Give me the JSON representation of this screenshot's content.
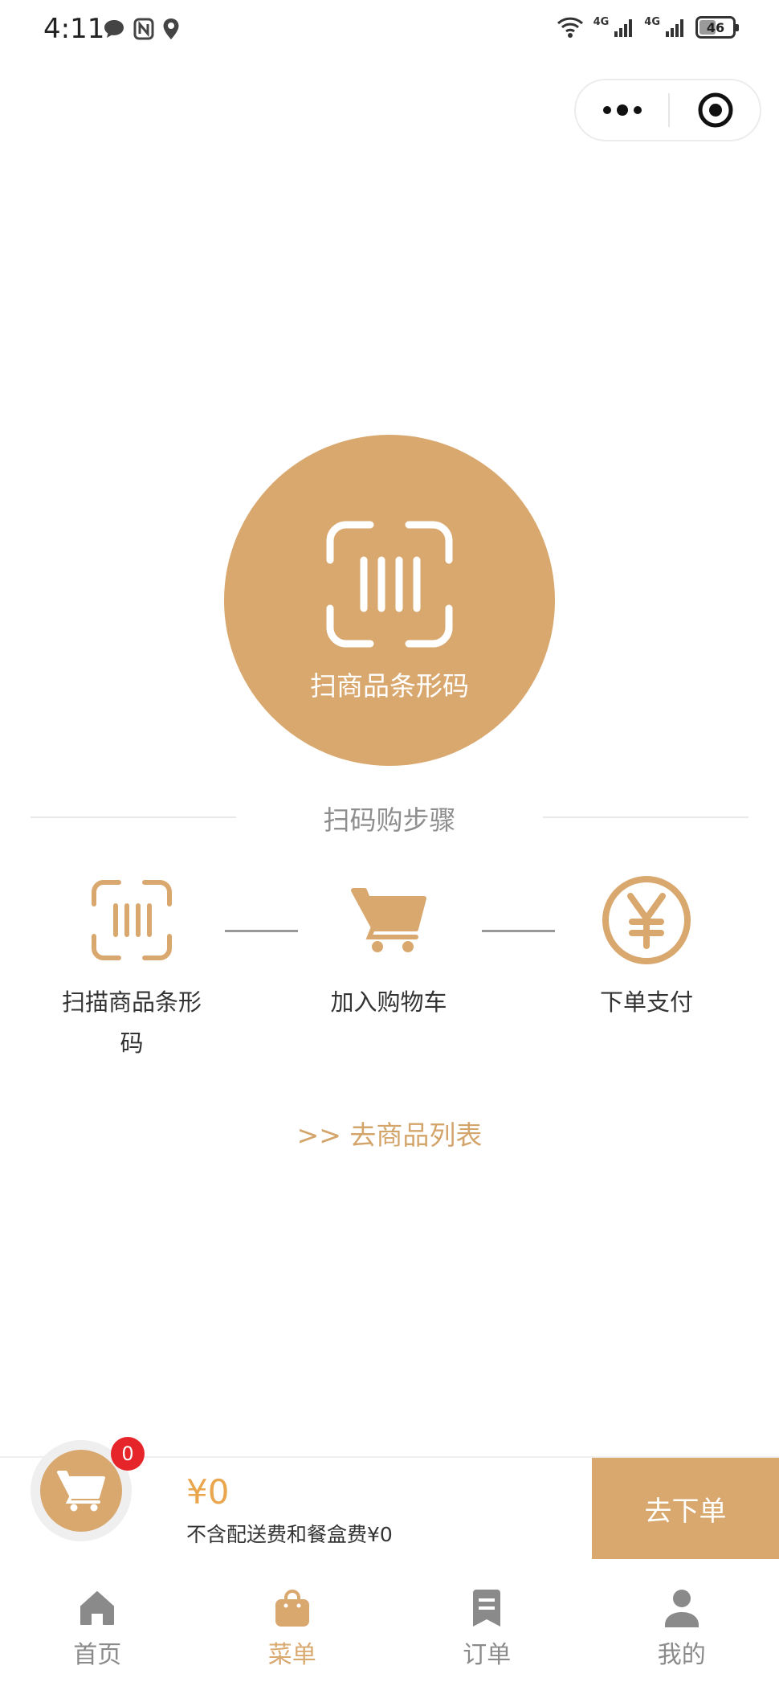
{
  "status_bar": {
    "time": "4:11",
    "network_1": "4G",
    "network_2": "4G",
    "battery": "46"
  },
  "capsule": {
    "more_icon": "more-dots-icon",
    "close_icon": "target-close-icon"
  },
  "scan": {
    "label": "扫商品条形码",
    "icon": "barcode-scan-icon",
    "color": "#d9a86f"
  },
  "steps": {
    "title": "扫码购步骤",
    "items": [
      {
        "label": "扫描商品条形码",
        "icon": "barcode-scan-icon"
      },
      {
        "label": "加入购物车",
        "icon": "cart-icon"
      },
      {
        "label": "下单支付",
        "icon": "yen-icon"
      }
    ]
  },
  "link": {
    "goods_list": ">> 去商品列表"
  },
  "cart": {
    "count": "0",
    "total": "¥0",
    "note": "不含配送费和餐盒费¥0",
    "checkout_label": "去下单"
  },
  "tabs": [
    {
      "label": "首页",
      "icon": "home-icon"
    },
    {
      "label": "菜单",
      "icon": "bag-icon",
      "active": true
    },
    {
      "label": "订单",
      "icon": "order-icon"
    },
    {
      "label": "我的",
      "icon": "user-icon"
    }
  ],
  "colors": {
    "accent": "#d9a86f",
    "price": "#e9a64d",
    "badge": "#e6252b"
  }
}
